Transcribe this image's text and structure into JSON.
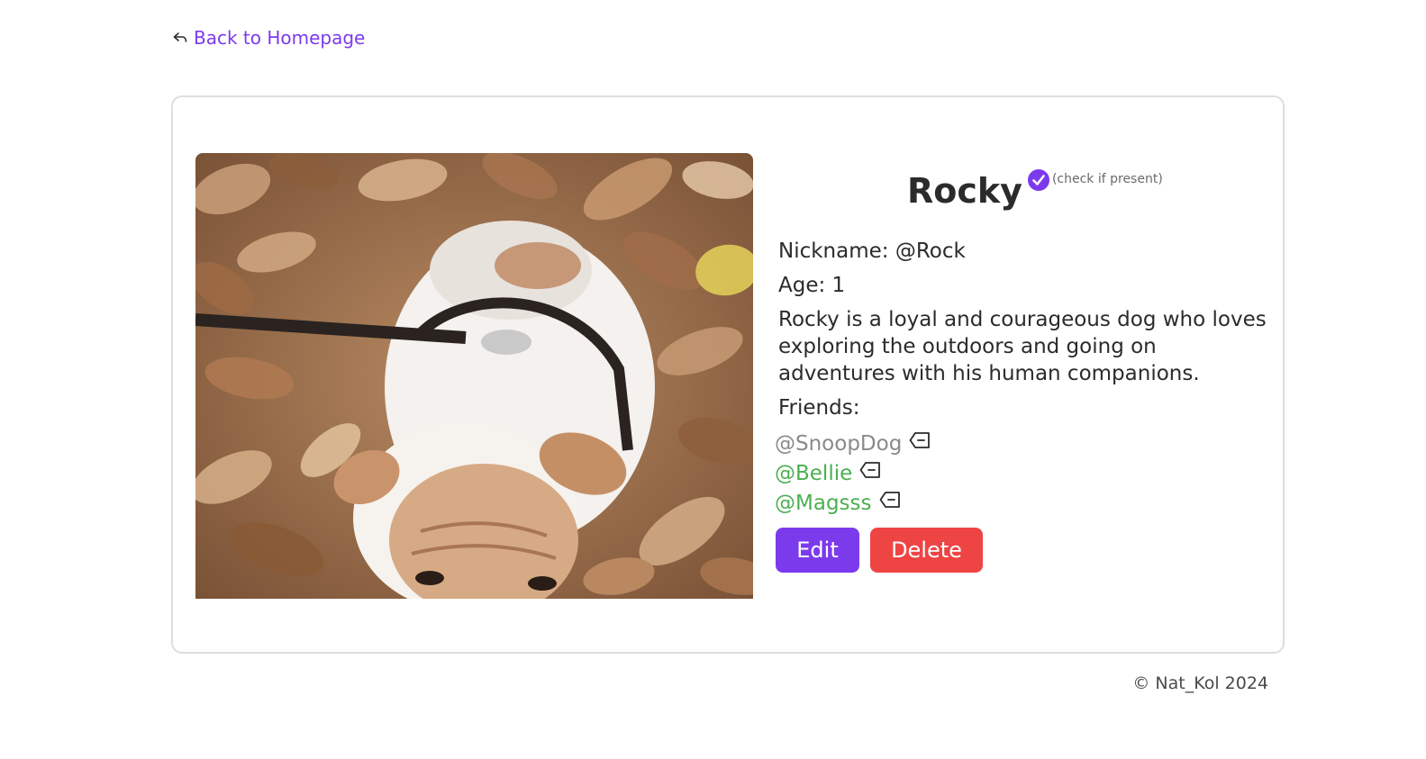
{
  "nav": {
    "back_label": "Back to Homepage",
    "back_icon": "reply-arrow-icon"
  },
  "pet": {
    "name": "Rocky",
    "present_icon": "check-circle-icon",
    "present_note": "(check if present)",
    "nickname_line": "Nickname: @Rock",
    "age_line": "Age: 1",
    "bio": "Rocky is a loyal and courageous dog who loves exploring the outdoors and going on adventures with his human companions.",
    "friends_label": "Friends:",
    "friends": [
      {
        "name": "@SnoopDog",
        "color": "#8a8a8a"
      },
      {
        "name": "@Bellie",
        "color": "#4caf50"
      },
      {
        "name": "@Magsss",
        "color": "#4caf50"
      }
    ],
    "remove_icon": "tag-remove-icon"
  },
  "actions": {
    "edit_label": "Edit",
    "delete_label": "Delete"
  },
  "colors": {
    "accent": "#7c3aed",
    "danger": "#ef4444",
    "friend_green": "#4caf50"
  },
  "footer": {
    "copyright": "© Nat_Kol 2024"
  }
}
